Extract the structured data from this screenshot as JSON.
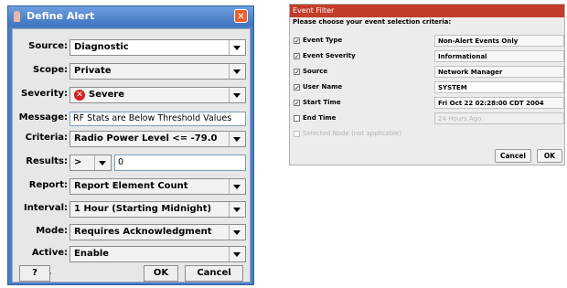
{
  "define_alert": {
    "title": "Define Alert",
    "close_glyph": "✕",
    "fields": {
      "source": {
        "label": "Source:",
        "value": "Diagnostic"
      },
      "scope": {
        "label": "Scope:",
        "value": "Private"
      },
      "severity": {
        "label": "Severity:",
        "value": "Severe",
        "icon_glyph": "✕"
      },
      "message": {
        "label": "Message:",
        "value": "RF Stats are Below Threshold Values"
      },
      "criteria": {
        "label": "Criteria:",
        "value": "Radio Power Level <= -79.0"
      },
      "results": {
        "label": "Results:",
        "operator": ">",
        "value": "0"
      },
      "report": {
        "label": "Report:",
        "value": "Report Element Count"
      },
      "interval": {
        "label": "Interval:",
        "value": "1 Hour (Starting Midnight)"
      },
      "mode": {
        "label": "Mode:",
        "value": "Requires Acknowledgment"
      },
      "active": {
        "label": "Active:",
        "value": "Enable"
      }
    },
    "buttons": {
      "help": "?",
      "ok": "OK",
      "cancel": "Cancel"
    }
  },
  "event_filter": {
    "title": "Event Filter",
    "prompt": "Please choose your event selection criteria:",
    "check_glyph": "✓",
    "rows": [
      {
        "label": "Event Type",
        "value": "Non-Alert Events Only",
        "checked": true
      },
      {
        "label": "Event Severity",
        "value": "Informational",
        "checked": true
      },
      {
        "label": "Source",
        "value": "Network Manager",
        "checked": true
      },
      {
        "label": "User Name",
        "value": "SYSTEM",
        "checked": true
      },
      {
        "label": "Start Time",
        "value": "Fri Oct 22 02:28:00 CDT 2004",
        "checked": true
      },
      {
        "label": "End Time",
        "value": "24 Hours Ago",
        "checked": false
      }
    ],
    "selected_node": {
      "label": "Selected Node (not applicable)"
    },
    "buttons": {
      "cancel": "Cancel",
      "ok": "OK"
    }
  },
  "colors": {
    "alert_frame": "#4a7fc4",
    "alert_panel": "#e7e7e7",
    "close_button": "#e8602c",
    "severity_red": "#d62020",
    "filter_titlebar": "#c43c2a"
  }
}
